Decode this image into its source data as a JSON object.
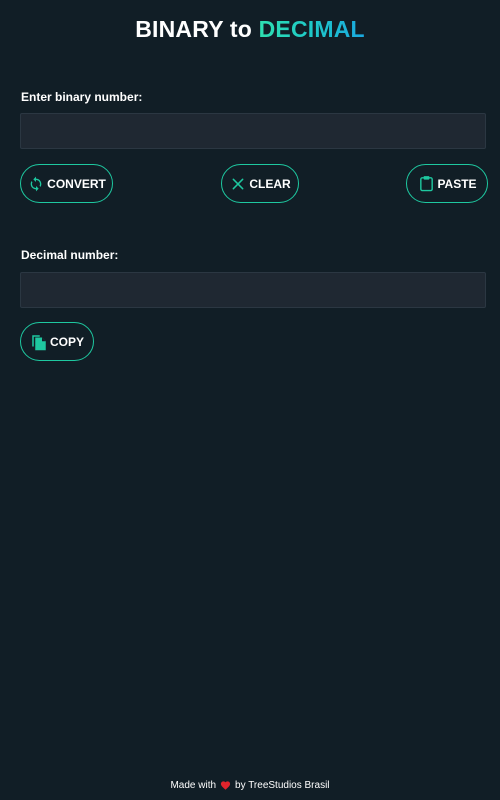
{
  "header": {
    "title_part1": "BINARY to ",
    "title_part2": "DECIMAL"
  },
  "input_section": {
    "label": "Enter binary number:",
    "value": "",
    "placeholder": ""
  },
  "buttons": {
    "convert": {
      "label": "CONVERT",
      "icon": "refresh-icon"
    },
    "clear": {
      "label": "CLEAR",
      "icon": "close-icon"
    },
    "paste": {
      "label": "PASTE",
      "icon": "clipboard-icon"
    },
    "copy": {
      "label": "COPY",
      "icon": "copy-icon"
    }
  },
  "output_section": {
    "label": "Decimal number:",
    "value": "",
    "placeholder": ""
  },
  "footer": {
    "made_with": "Made with",
    "heart_icon": "heart-icon",
    "by": "by TreeStudios Brasil"
  },
  "colors": {
    "background": "#111e26",
    "field_background": "#1f2832",
    "accent": "#1ec8a0",
    "heart": "#e0242c"
  }
}
